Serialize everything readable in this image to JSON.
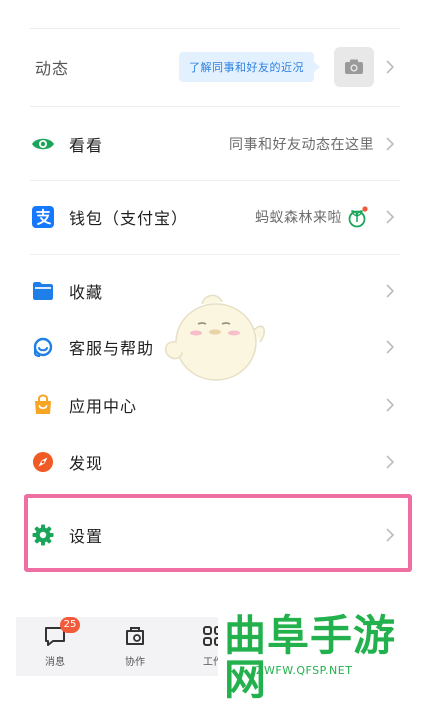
{
  "dynamic": {
    "label": "动态",
    "bubble_text": "了解同事和好友的近况",
    "camera_icon": "camera-icon"
  },
  "menu": [
    {
      "label": "看看",
      "right_text": "同事和好友动态在这里",
      "icon": "eye-icon",
      "color": "#1aa65a"
    },
    {
      "label": "钱包（支付宝）",
      "right_text": "蚂蚁森林来啦",
      "icon": "alipay-icon",
      "color": "#1677ff"
    },
    {
      "label": "收藏",
      "right_text": "",
      "icon": "folder-icon",
      "color": "#1f7fe8"
    },
    {
      "label": "客服与帮助",
      "right_text": "",
      "icon": "headset-icon",
      "color": "#1f7fe8"
    },
    {
      "label": "应用中心",
      "right_text": "",
      "icon": "bag-icon",
      "color": "#f6a623"
    },
    {
      "label": "发现",
      "right_text": "",
      "icon": "compass-icon",
      "color": "#f05a24"
    },
    {
      "label": "设置",
      "right_text": "",
      "icon": "gear-icon",
      "color": "#1aa65a"
    }
  ],
  "tabbar": {
    "messages_label": "消息",
    "messages_badge": "25",
    "collab_label": "协作",
    "work_label": "工作"
  },
  "watermark": {
    "main": "曲阜手游网",
    "sub": "ZWFW.QFSP.NET"
  },
  "colors": {
    "highlight": "#f06fa3",
    "watermark": "#22b14c",
    "badge": "#f25a3a"
  }
}
